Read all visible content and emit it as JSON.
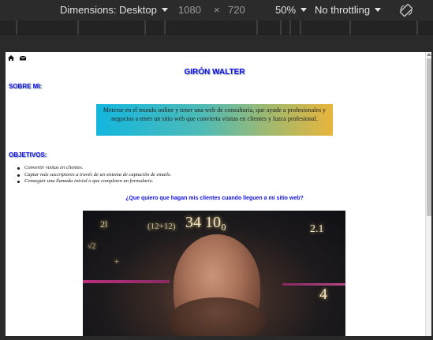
{
  "devtools": {
    "dimensions_label": "Dimensions: Desktop",
    "width": "1080",
    "times": "×",
    "height": "720",
    "zoom": "50%",
    "throttling": "No throttling"
  },
  "page": {
    "title": "GIRÓN WALTER",
    "about_heading": "SOBRE MI:",
    "about_text": "Meterse en el mundo online y tener una web de consultoría, que ayude a profesionales y negocios a tener un sitio web que convierta visitas en clientes y luzca profesional.",
    "objectives_heading": "OBJETIVOS:",
    "objectives": [
      "Convertir visitas en clientes.",
      "Captar más suscriptores a través de un sistema de captación de emails.",
      "Conseguir una llamada inicial o que completen un formulario."
    ],
    "question": "¿Que quiero que hagan mis clientes cuando lleguen a mi sitio web?",
    "nav_icons": [
      "home-icon",
      "envelope-icon"
    ],
    "photo_math": {
      "m1": "34 10₀",
      "m2": "2l",
      "m3": "(12+12)",
      "m4": "2.1",
      "m5": "4",
      "m6": "√2",
      "m7": "+"
    }
  }
}
